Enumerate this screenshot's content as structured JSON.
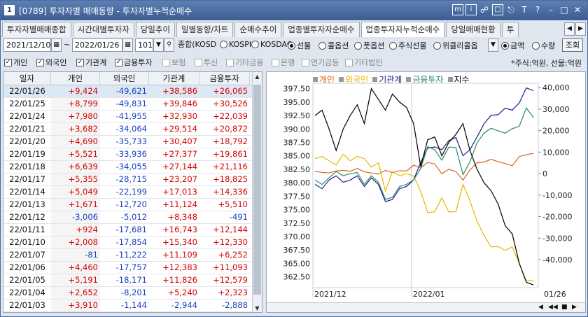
{
  "window": {
    "number": "1",
    "title": "[0789] 투자자별 매매동향 - 투자자별누적순매수",
    "icons": [
      "m-icon",
      "info-icon",
      "link-icon",
      "window-icon",
      "pin-icon",
      "text-icon",
      "help-icon",
      "minimize-icon",
      "maximize-icon",
      "close-icon"
    ]
  },
  "tabs": [
    "투자자별매매종합",
    "시간대별투자자",
    "당일추이",
    "일별동향/차트",
    "순매수추이",
    "업종별투자자순매수",
    "업종투자자누적순매수",
    "당일매매현황",
    "투"
  ],
  "filters": {
    "start_date": "2021/12/10",
    "end_date": "2022/01/26",
    "code": "101",
    "market_label": "종합(KOSD",
    "markets": [
      "KOSPI",
      "KOSDAQ",
      "선물",
      "콜옵션",
      "풋옵션",
      "주식선물",
      "위클리콜옵"
    ],
    "selected_market": "선물",
    "value_types": [
      "금액",
      "수량"
    ],
    "selected_value_type": "금액",
    "search_button": "조회"
  },
  "investors": [
    {
      "label": "개인",
      "checked": true,
      "enabled": true
    },
    {
      "label": "외국인",
      "checked": true,
      "enabled": true
    },
    {
      "label": "기관계",
      "checked": true,
      "enabled": true
    },
    {
      "label": "금융투자",
      "checked": true,
      "enabled": true
    },
    {
      "label": "보험",
      "checked": false,
      "enabled": false
    },
    {
      "label": "투신",
      "checked": false,
      "enabled": false
    },
    {
      "label": "기타금융",
      "checked": false,
      "enabled": false
    },
    {
      "label": "은행",
      "checked": false,
      "enabled": false
    },
    {
      "label": "연기금등",
      "checked": false,
      "enabled": false
    },
    {
      "label": "기타법인",
      "checked": false,
      "enabled": false
    }
  ],
  "unit_note": "*주식:억원, 선물:억원",
  "table": {
    "columns": [
      "일자",
      "개인",
      "외국인",
      "기관계",
      "금융투자"
    ],
    "rows": [
      [
        "22/01/26",
        "+9,424",
        "-49,621",
        "+38,586",
        "+26,065"
      ],
      [
        "22/01/25",
        "+8,799",
        "-49,831",
        "+39,846",
        "+30,526"
      ],
      [
        "22/01/24",
        "+7,980",
        "-41,955",
        "+32,930",
        "+22,039"
      ],
      [
        "22/01/21",
        "+3,682",
        "-34,064",
        "+29,514",
        "+20,872"
      ],
      [
        "22/01/20",
        "+4,690",
        "-35,733",
        "+30,407",
        "+18,792"
      ],
      [
        "22/01/19",
        "+5,521",
        "-33,936",
        "+27,377",
        "+19,861"
      ],
      [
        "22/01/18",
        "+6,639",
        "-34,055",
        "+27,144",
        "+21,116"
      ],
      [
        "22/01/17",
        "+5,355",
        "-28,715",
        "+23,207",
        "+18,825"
      ],
      [
        "22/01/14",
        "+5,049",
        "-22,199",
        "+17,013",
        "+14,336"
      ],
      [
        "22/01/13",
        "+1,671",
        "-12,720",
        "+11,124",
        "+5,510"
      ],
      [
        "22/01/12",
        "-3,006",
        "-5,012",
        "+8,348",
        "-491"
      ],
      [
        "22/01/11",
        "+924",
        "-17,681",
        "+16,743",
        "+12,144"
      ],
      [
        "22/01/10",
        "+2,008",
        "-17,854",
        "+15,340",
        "+12,330"
      ],
      [
        "22/01/07",
        "-81",
        "-11,222",
        "+11,109",
        "+6,252"
      ],
      [
        "22/01/06",
        "+4,460",
        "-17,757",
        "+12,383",
        "+11,093"
      ],
      [
        "22/01/05",
        "+5,191",
        "-18,171",
        "+11,826",
        "+12,579"
      ],
      [
        "22/01/04",
        "+2,652",
        "-8,201",
        "+5,240",
        "+2,323"
      ],
      [
        "22/01/03",
        "+3,910",
        "-1,144",
        "-2,944",
        "-2,888"
      ]
    ]
  },
  "chart_data": {
    "type": "line",
    "legend": [
      "개인",
      "외국인",
      "기관계",
      "금융투자",
      "지수"
    ],
    "colors": {
      "개인": "#e0661a",
      "외국인": "#e8b800",
      "기관계": "#1c1c8c",
      "금융투자": "#2a8a6a",
      "지수": "#000000"
    },
    "left_axis": {
      "ticks": [
        "397.50",
        "395.00",
        "392.50",
        "390.00",
        "387.50",
        "385.00",
        "382.50",
        "380.00",
        "377.50",
        "375.00",
        "372.50",
        "370.00",
        "367.50",
        "365.00",
        "362.50"
      ],
      "range": [
        360.5,
        398.5
      ]
    },
    "right_axis": {
      "ticks": [
        "40,000",
        "30,000",
        "20,000",
        "10,000",
        "0",
        "-10,000",
        "-20,000",
        "-30,000",
        "-40,000"
      ],
      "range": [
        -53000,
        42000
      ]
    },
    "x_labels": [
      "2021/12",
      "2022/01",
      "01/26"
    ],
    "x_divider_index": 14,
    "series": [
      {
        "name": "개인",
        "axis": "right",
        "values": [
          1000,
          600,
          300,
          1200,
          1500,
          1100,
          2400,
          800,
          300,
          -200,
          1500,
          500,
          1300,
          1200,
          3910,
          2652,
          5191,
          4460,
          -81,
          2008,
          924,
          -3006,
          1671,
          5049,
          5355,
          6639,
          5521,
          4690,
          3682,
          7980,
          8799,
          9424
        ]
      },
      {
        "name": "외국인",
        "axis": "right",
        "values": [
          7000,
          8000,
          6000,
          4000,
          9000,
          6000,
          8000,
          7000,
          3000,
          5000,
          -8000,
          1000,
          -1000,
          0,
          -1144,
          -8201,
          -18171,
          -17757,
          -11222,
          -17854,
          -17681,
          -5012,
          -12720,
          -22199,
          -28715,
          -34055,
          -33936,
          -35733,
          -34064,
          -41955,
          -49831,
          -49621
        ]
      },
      {
        "name": "기관계",
        "axis": "right",
        "values": [
          -5000,
          -7000,
          -3000,
          -1000,
          -4000,
          -3000,
          -1000,
          -6000,
          -2000,
          -5000,
          -13000,
          -12000,
          -7000,
          -6000,
          -2944,
          5240,
          11826,
          12383,
          11109,
          15340,
          16743,
          8348,
          11124,
          17013,
          23207,
          27144,
          27377,
          30407,
          29514,
          32930,
          39846,
          38586
        ]
      },
      {
        "name": "금융투자",
        "axis": "right",
        "values": [
          -3000,
          -5000,
          -2000,
          1000,
          -1000,
          0,
          500,
          -5000,
          -1000,
          -4000,
          -12000,
          -11000,
          -6000,
          -5000,
          -2888,
          2323,
          12579,
          11093,
          6252,
          12330,
          12144,
          -491,
          5510,
          14336,
          18825,
          21116,
          19861,
          18792,
          20872,
          22039,
          30526,
          26065
        ]
      },
      {
        "name": "지수",
        "axis": "left",
        "values": [
          392.5,
          393.5,
          390.0,
          386.0,
          390.0,
          392.5,
          394.5,
          391.0,
          397.5,
          395.5,
          393.5,
          396.5,
          395.0,
          394.0,
          391.0,
          383.0,
          388.0,
          388.5,
          385.0,
          387.5,
          389.0,
          391.0,
          386.0,
          382.5,
          380.0,
          378.5,
          376.0,
          372.0,
          370.5,
          365.0,
          361.5,
          361.0
        ]
      }
    ]
  }
}
